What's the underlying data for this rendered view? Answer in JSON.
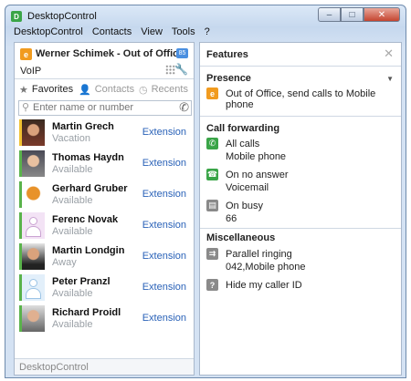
{
  "window": {
    "title": "DesktopControl",
    "app_icon": "app-icon",
    "min_glyph": "–",
    "max_glyph": "□",
    "close_glyph": "✕"
  },
  "menu": [
    "DesktopControl",
    "Contacts",
    "View",
    "Tools",
    "?"
  ],
  "user": {
    "status_glyph": "e",
    "name": "Werner Schimek - Out of Office",
    "line": "VoIP",
    "chat_glyph": "85"
  },
  "tabs": [
    {
      "label": "Favorites",
      "icon": "star-icon",
      "glyph": "★"
    },
    {
      "label": "Contacts",
      "icon": "person-icon",
      "glyph": "👤"
    },
    {
      "label": "Recents",
      "icon": "clock-icon",
      "glyph": "◷"
    }
  ],
  "search": {
    "placeholder": "Enter name or number"
  },
  "contacts": [
    {
      "name": "Martin Grech",
      "status": "Vacation",
      "action": "Extension",
      "presence": "away",
      "avatar": "photo1"
    },
    {
      "name": "Thomas Haydn",
      "status": "Available",
      "action": "Extension",
      "presence": "available",
      "avatar": "photo2"
    },
    {
      "name": "Gerhard Gruber",
      "status": "Available",
      "action": "Extension",
      "presence": "available",
      "avatar": "photo3"
    },
    {
      "name": "Ferenc Novak",
      "status": "Available",
      "action": "Extension",
      "presence": "available",
      "avatar": "placeholder"
    },
    {
      "name": "Martin Londgin",
      "status": "Away",
      "action": "Extension",
      "presence": "available",
      "avatar": "photo4"
    },
    {
      "name": "Peter Pranzl",
      "status": "Available",
      "action": "Extension",
      "presence": "available",
      "avatar": "placeholder-blue"
    },
    {
      "name": "Richard Proidl",
      "status": "Available",
      "action": "Extension",
      "presence": "available",
      "avatar": "photo5"
    }
  ],
  "left_footer": "DesktopControl",
  "features": {
    "title": "Features",
    "close_glyph": "✕",
    "presence": {
      "title": "Presence",
      "caret": "▼",
      "glyph": "e",
      "text": "Out of Office, send calls to Mobile phone"
    },
    "call_forwarding": {
      "title": "Call forwarding",
      "all_calls": {
        "label": "All calls",
        "value": "Mobile phone",
        "glyph": "✆"
      },
      "no_answer": {
        "label": "On no answer",
        "value": "Voicemail",
        "glyph": "☎"
      },
      "on_busy": {
        "label": "On busy",
        "value": "66",
        "glyph": "▤"
      }
    },
    "misc": {
      "title": "Miscellaneous",
      "parallel": {
        "label": "Parallel ringing",
        "value": "042,Mobile phone",
        "glyph": "⇉"
      },
      "hide_id": {
        "label": "Hide my caller ID",
        "glyph": "?"
      }
    }
  },
  "colors": {
    "accent_link": "#2a62b8",
    "available": "#5ab34b",
    "away": "#f1c232",
    "out_of_office": "#f19b1f"
  }
}
